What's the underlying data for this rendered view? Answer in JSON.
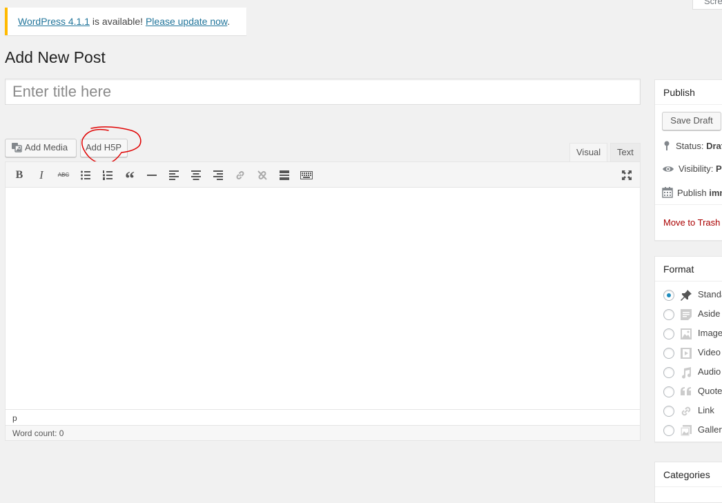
{
  "screen_options": {
    "label": "Screen Options"
  },
  "notice": {
    "link1": "WordPress 4.1.1",
    "middle": " is available! ",
    "link2": "Please update now",
    "end": "."
  },
  "page_title": "Add New Post",
  "title_input": {
    "placeholder": "Enter title here",
    "value": ""
  },
  "media_buttons": {
    "add_media": "Add Media",
    "add_h5p": "Add H5P"
  },
  "editor_tabs": {
    "visual": "Visual",
    "text": "Text",
    "active": "visual"
  },
  "toolbar": {
    "bold": "B",
    "italic": "I",
    "strikethrough": "ABC",
    "quote": "“"
  },
  "editor": {
    "path": "p",
    "word_count": "Word count: 0"
  },
  "publish": {
    "title": "Publish",
    "save_draft": "Save Draft",
    "status_label": "Status: ",
    "status_value": "Draft",
    "visibility_label": "Visibility: ",
    "visibility_value": "Public",
    "publish_label": "Publish ",
    "publish_value": "immediately",
    "trash": "Move to Trash"
  },
  "format": {
    "title": "Format",
    "selected": "Standard",
    "options": [
      "Standard",
      "Aside",
      "Image",
      "Video",
      "Audio",
      "Quote",
      "Link",
      "Gallery"
    ]
  },
  "categories": {
    "title": "Categories"
  },
  "colors": {
    "notice_border": "#ffba00",
    "link": "#21759b",
    "trash": "#aa0000",
    "radio_selected": "#1e8cbe",
    "annotation": "#e00000"
  }
}
